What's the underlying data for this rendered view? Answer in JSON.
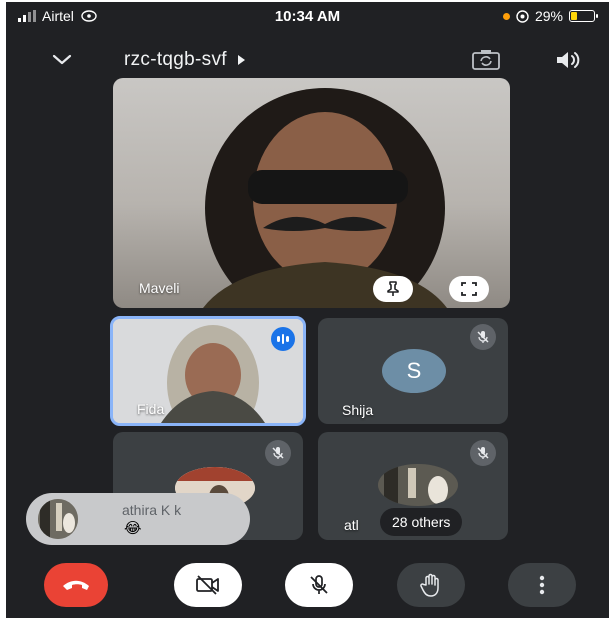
{
  "status_bar": {
    "carrier": "Airtel",
    "time": "10:34 AM",
    "battery": "29%",
    "battery_level": 0.29,
    "icons": [
      "signal-icon",
      "wifi-call-icon",
      "location-icon",
      "battery-icon"
    ]
  },
  "top_bar": {
    "meeting_code": "rzc-tqgb-svf",
    "icons": [
      "chevron-down-icon",
      "caret-right-icon",
      "switch-camera-icon",
      "speaker-icon"
    ]
  },
  "main_tile": {
    "name": "Maveli",
    "icons": [
      "pin-icon",
      "fullscreen-icon"
    ]
  },
  "tiles": {
    "fida": {
      "name": "Fida",
      "speaking": true
    },
    "shija": {
      "name": "Shija",
      "avatar_letter": "S",
      "muted": true
    },
    "bottom_left": {
      "muted": true
    },
    "bottom_right": {
      "name_partial": "atl",
      "others_label": "28 others",
      "muted": true
    }
  },
  "reaction": {
    "name": "athira K k",
    "emoji": "😂"
  },
  "controls": {
    "icons": [
      "end-call-icon",
      "camera-off-icon",
      "mic-off-icon",
      "raise-hand-icon",
      "more-options-icon"
    ]
  },
  "colors": {
    "background": "#202124",
    "tile": "#3c4043",
    "end_call": "#ea4335",
    "speaking_blue": "#1a73e8",
    "active_border": "#8ab4f8"
  }
}
